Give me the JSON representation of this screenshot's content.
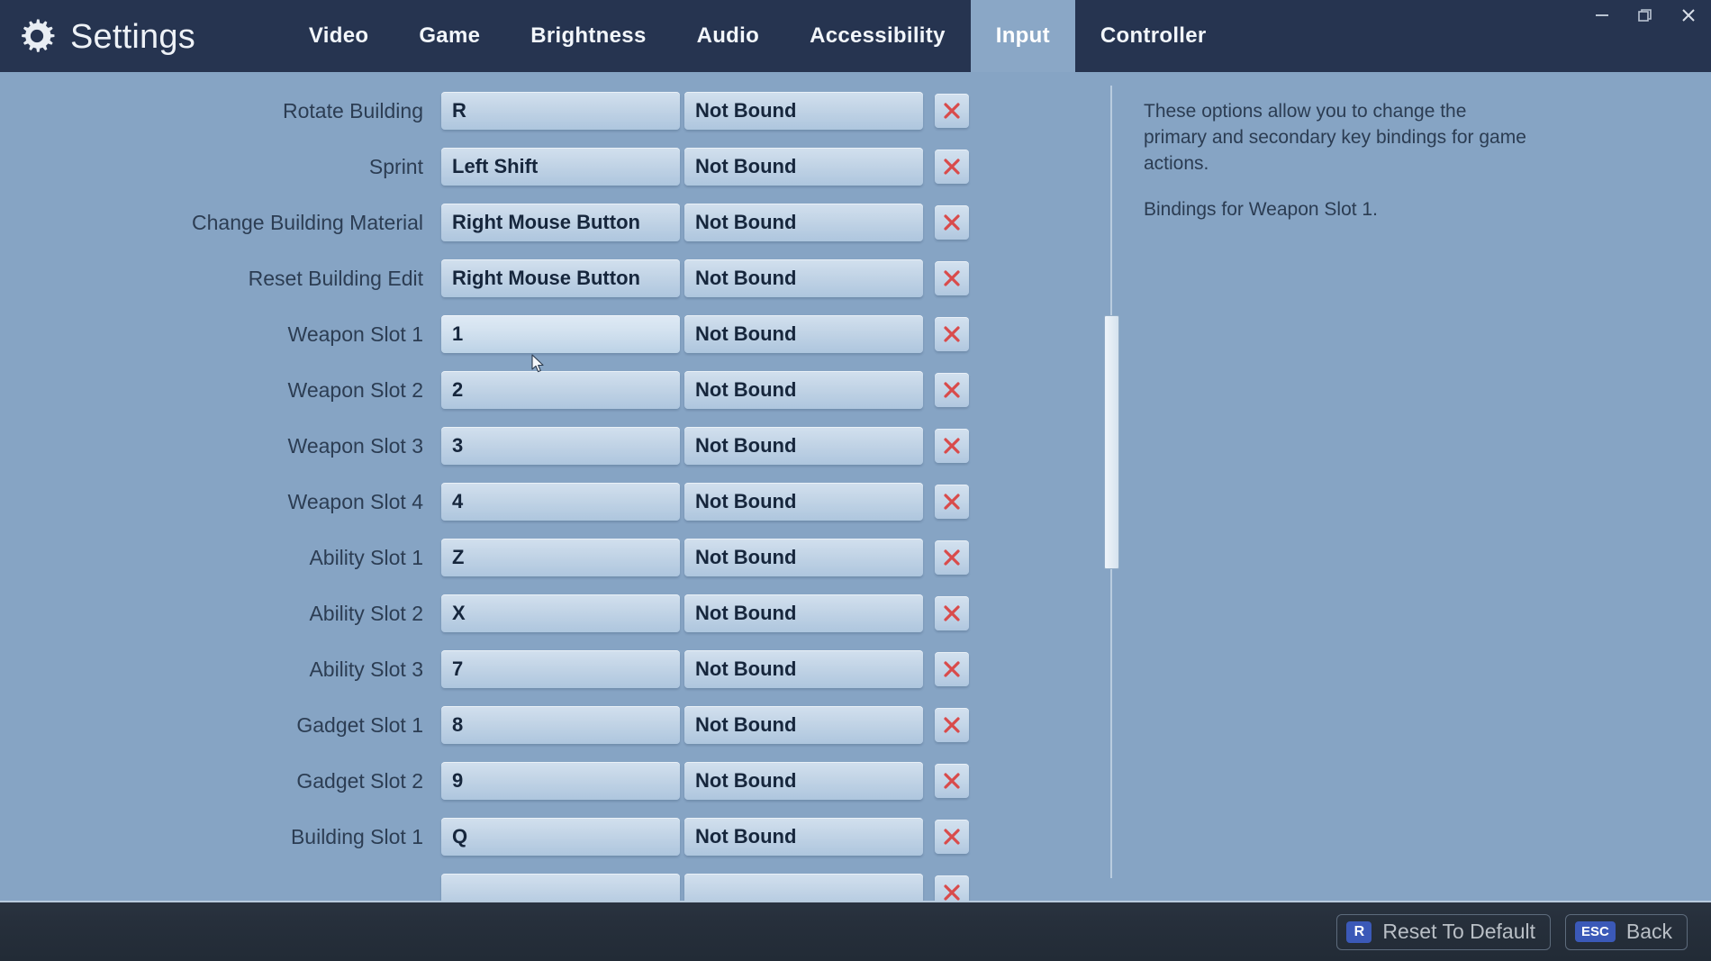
{
  "window": {
    "controls": [
      {
        "name": "minimize",
        "glyph": "minimize-icon"
      },
      {
        "name": "restore",
        "glyph": "restore-icon"
      },
      {
        "name": "close",
        "glyph": "close-icon"
      }
    ]
  },
  "header": {
    "icon": "gear-icon",
    "title": "Settings",
    "bar_color": "#263450",
    "tabs": [
      {
        "label": "Video",
        "active": false
      },
      {
        "label": "Game",
        "active": false
      },
      {
        "label": "Brightness",
        "active": false
      },
      {
        "label": "Audio",
        "active": false
      },
      {
        "label": "Accessibility",
        "active": false
      },
      {
        "label": "Input",
        "active": true
      },
      {
        "label": "Controller",
        "active": false
      }
    ],
    "active_tab": "Input",
    "active_tab_bg": "#8aa7c6"
  },
  "page": {
    "background_color": "#86a4c4",
    "label_color": "#2c3d53",
    "field_text_color": "#16263c",
    "clear_icon_color": "#d94b4b"
  },
  "bindings": {
    "clear_icon": "close-icon",
    "unbound_text": "Not Bound",
    "rows": [
      {
        "action": "Rotate Building",
        "primary": "R",
        "secondary": "Not Bound",
        "hovered": false
      },
      {
        "action": "Sprint",
        "primary": "Left Shift",
        "secondary": "Not Bound",
        "hovered": false
      },
      {
        "action": "Change Building Material",
        "primary": "Right Mouse Button",
        "secondary": "Not Bound",
        "hovered": false
      },
      {
        "action": "Reset Building Edit",
        "primary": "Right Mouse Button",
        "secondary": "Not Bound",
        "hovered": false
      },
      {
        "action": "Weapon Slot 1",
        "primary": "1",
        "secondary": "Not Bound",
        "hovered": true
      },
      {
        "action": "Weapon Slot 2",
        "primary": "2",
        "secondary": "Not Bound",
        "hovered": false
      },
      {
        "action": "Weapon Slot 3",
        "primary": "3",
        "secondary": "Not Bound",
        "hovered": false
      },
      {
        "action": "Weapon Slot 4",
        "primary": "4",
        "secondary": "Not Bound",
        "hovered": false
      },
      {
        "action": "Ability Slot 1",
        "primary": "Z",
        "secondary": "Not Bound",
        "hovered": false
      },
      {
        "action": "Ability Slot 2",
        "primary": "X",
        "secondary": "Not Bound",
        "hovered": false
      },
      {
        "action": "Ability Slot 3",
        "primary": "7",
        "secondary": "Not Bound",
        "hovered": false
      },
      {
        "action": "Gadget Slot 1",
        "primary": "8",
        "secondary": "Not Bound",
        "hovered": false
      },
      {
        "action": "Gadget Slot 2",
        "primary": "9",
        "secondary": "Not Bound",
        "hovered": false
      },
      {
        "action": "Building Slot 1",
        "primary": "Q",
        "secondary": "Not Bound",
        "hovered": false
      },
      {
        "action": "",
        "primary": "",
        "secondary": "",
        "hovered": false
      }
    ]
  },
  "description": {
    "paragraph_1": "These options allow you to change the primary and secondary key bindings for game actions.",
    "paragraph_2": "Bindings for Weapon Slot 1."
  },
  "scrollbar": {
    "thumb_top_pct": 29,
    "thumb_height_pct": 32
  },
  "footer": {
    "reset": {
      "key": "R",
      "label": "Reset To Default"
    },
    "back": {
      "key": "ESC",
      "label": "Back"
    },
    "keycap_color": "#3b59b8",
    "label_color": "#b9bfc6"
  }
}
